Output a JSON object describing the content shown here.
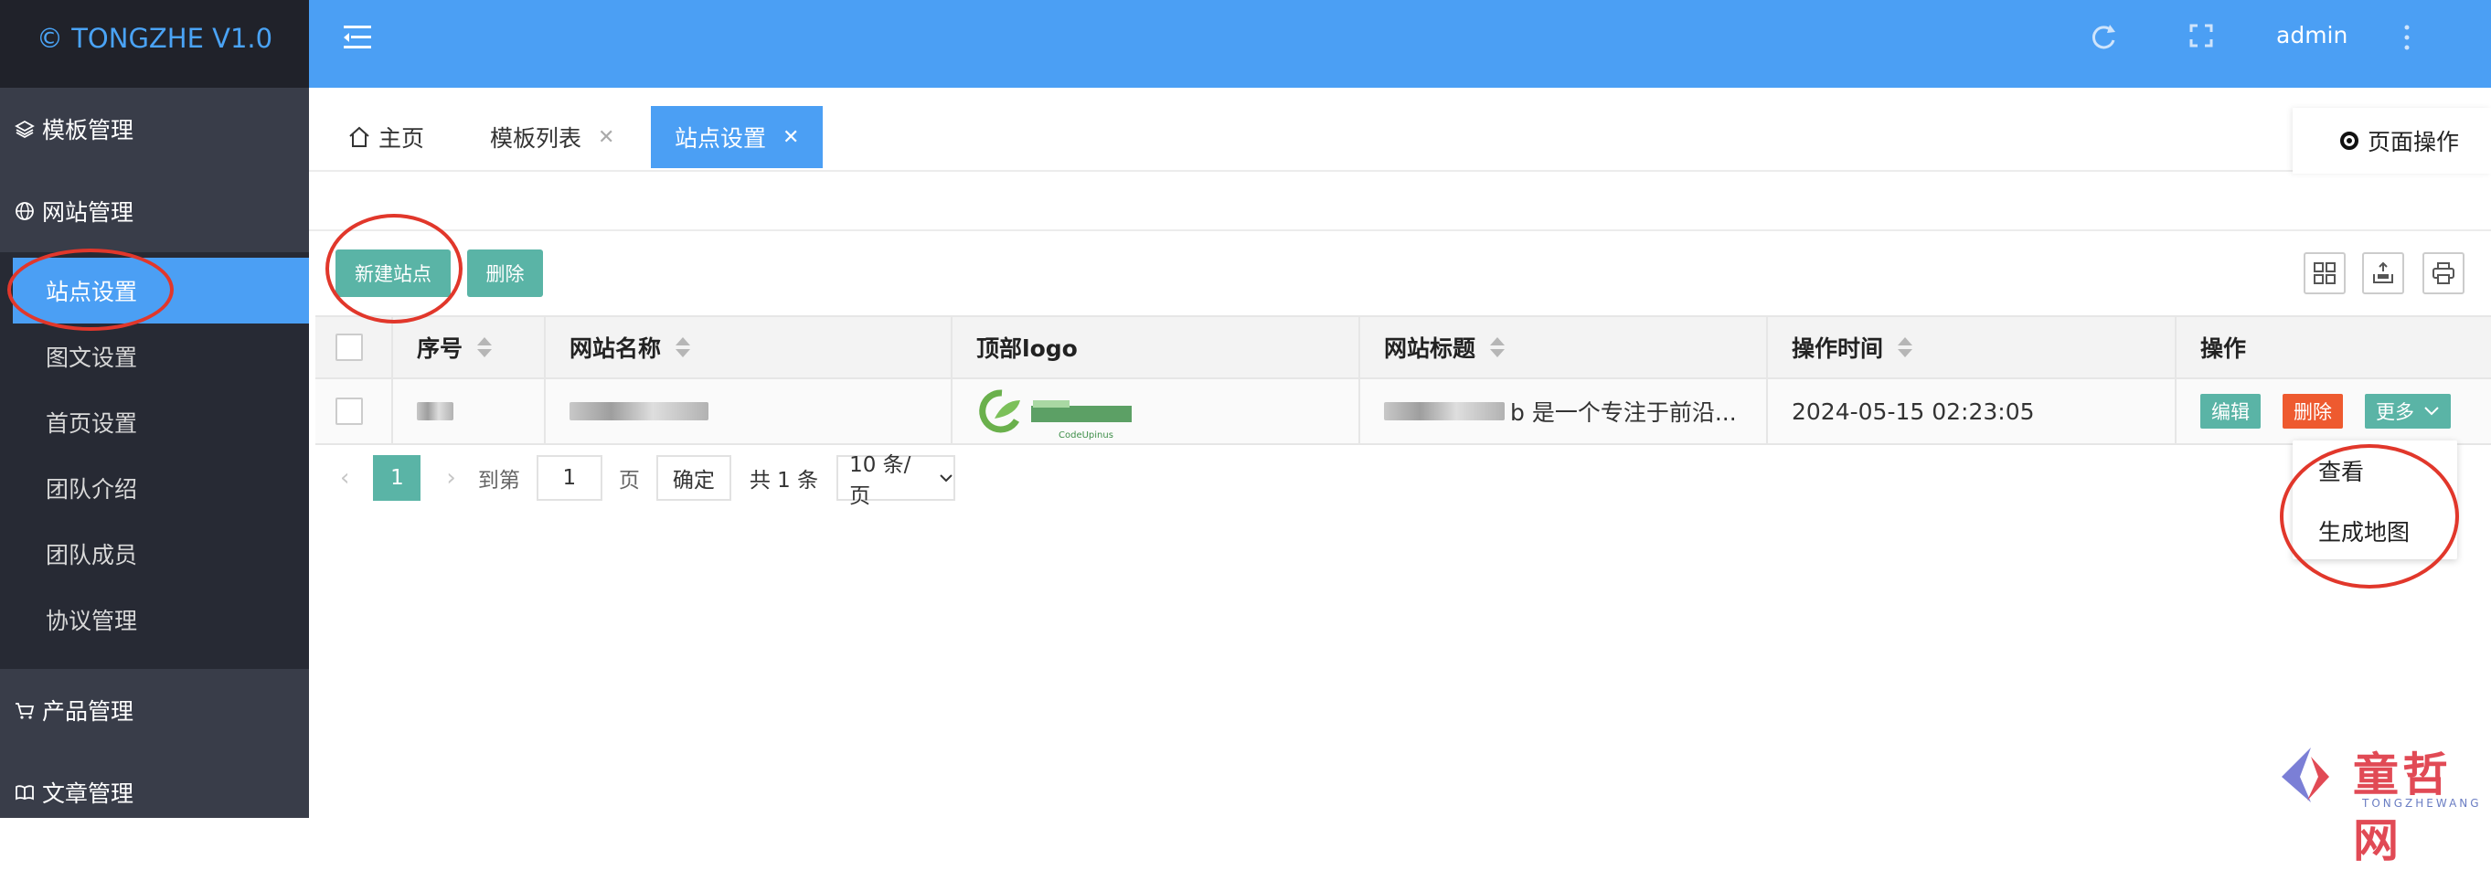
{
  "app": {
    "logo_text": "© TONGZHE V1.0",
    "user": "admin"
  },
  "sidebar": {
    "groups": [
      {
        "label": "模板管理",
        "icon": "layers-icon"
      },
      {
        "label": "网站管理",
        "icon": "globe-icon"
      },
      {
        "label": "产品管理",
        "icon": "cart-icon"
      },
      {
        "label": "文章管理",
        "icon": "book-icon"
      }
    ],
    "sub_items": [
      "站点设置",
      "图文设置",
      "首页设置",
      "团队介绍",
      "团队成员",
      "协议管理"
    ],
    "active_sub": "站点设置"
  },
  "tabs": [
    {
      "label": "主页",
      "closable": false
    },
    {
      "label": "模板列表",
      "closable": true
    },
    {
      "label": "站点设置",
      "closable": true,
      "active": true
    }
  ],
  "page_ops_label": "页面操作",
  "toolbar": {
    "new_label": "新建站点",
    "delete_label": "删除"
  },
  "table": {
    "columns": [
      "序号",
      "网站名称",
      "顶部logo",
      "网站标题",
      "操作时间",
      "操作"
    ],
    "rows": [
      {
        "title_visible": "b 是一个专注于前沿...",
        "logo_caption": "CodeUpinus",
        "time": "2024-05-15 02:23:05",
        "actions": {
          "edit": "编辑",
          "delete": "删除",
          "more": "更多"
        }
      }
    ]
  },
  "pagination": {
    "current": "1",
    "goto_label": "到第",
    "goto_value": "1",
    "page_label": "页",
    "confirm": "确定",
    "total": "共 1 条",
    "page_size": "10 条/页"
  },
  "more_menu": [
    "查看",
    "生成地图"
  ],
  "watermark": {
    "text": "童哲网",
    "sub": "TONGZHEWANG"
  },
  "colors": {
    "primary": "#4b9ff4",
    "sidebar": "#393d49",
    "submenu": "#272a34",
    "teal": "#5ab4a6",
    "danger": "#ee5a2f",
    "annotation": "#e1372b"
  }
}
